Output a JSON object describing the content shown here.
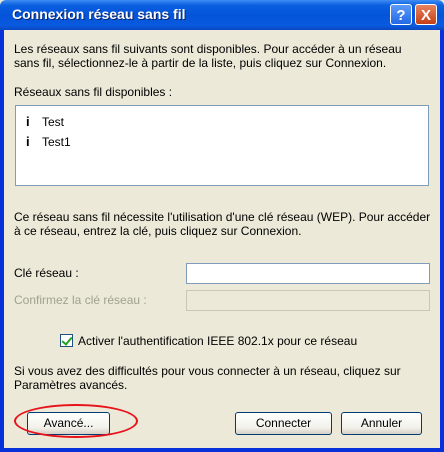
{
  "window": {
    "title": "Connexion réseau sans fil",
    "help_symbol": "?",
    "close_symbol": "X"
  },
  "intro": "Les réseaux sans fil suivants sont disponibles. Pour accéder à un réseau sans fil, sélectionnez-le à partir de la liste, puis cliquez sur Connexion.",
  "available_label": "Réseaux sans fil disponibles :",
  "networks": [
    {
      "name": "Test",
      "icon": "antenna-icon"
    },
    {
      "name": "Test1",
      "icon": "antenna-icon"
    }
  ],
  "wep_notice": "Ce réseau sans fil nécessite l'utilisation d'une clé réseau (WEP). Pour accéder à ce réseau, entrez la clé, puis cliquez sur Connexion.",
  "key_field": {
    "label": "Clé réseau :",
    "value": ""
  },
  "confirm_field": {
    "label": "Confirmez la clé réseau :",
    "value": ""
  },
  "ieee_checkbox": {
    "label": "Activer l'authentification IEEE 802.1x pour ce réseau",
    "checked": true
  },
  "help_text": "Si vous avez des difficultés pour vous connecter à un réseau, cliquez sur Paramètres avancés.",
  "buttons": {
    "advanced": "Avancé...",
    "connect": "Connecter",
    "cancel": "Annuler"
  },
  "colors": {
    "titlebar": "#0454d9",
    "dialog_bg": "#ece9d8",
    "highlight": "#e8121a"
  }
}
